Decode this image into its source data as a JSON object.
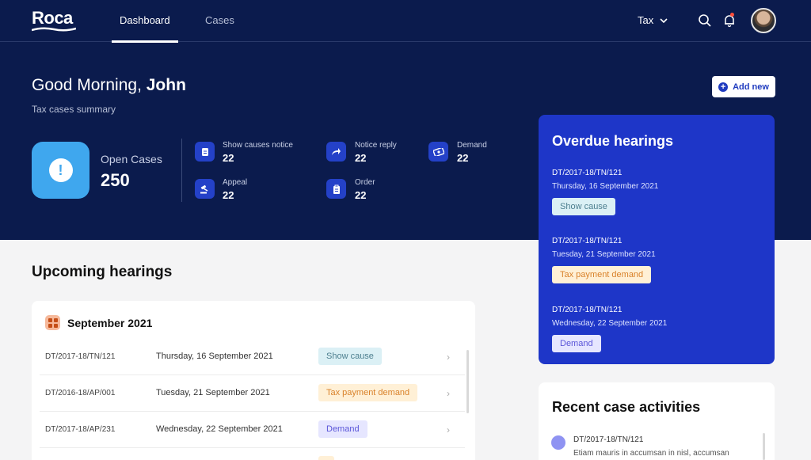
{
  "app": {
    "logo_text": "Roca"
  },
  "nav": {
    "tabs": [
      {
        "label": "Dashboard"
      },
      {
        "label": "Cases"
      }
    ],
    "tax_dropdown": "Tax",
    "icons": [
      "search-icon",
      "bell-icon",
      "avatar"
    ]
  },
  "hero": {
    "greeting_prefix": "Good Morning, ",
    "user_name": "John",
    "subtitle": "Tax cases summary",
    "add_new_label": "Add new",
    "open_cases": {
      "label": "Open Cases",
      "value": "250"
    },
    "stats": [
      {
        "label": "Show causes notice",
        "value": "22",
        "icon": "document-icon"
      },
      {
        "label": "Notice reply",
        "value": "22",
        "icon": "reply-arrow-icon"
      },
      {
        "label": "Demand",
        "value": "22",
        "icon": "money-icon"
      },
      {
        "label": "Appeal",
        "value": "22",
        "icon": "gavel-icon"
      },
      {
        "label": "Order",
        "value": "22",
        "icon": "clipboard-icon"
      }
    ]
  },
  "overdue": {
    "title": "Overdue hearings",
    "items": [
      {
        "case": "DT/2017-18/TN/121",
        "date": "Thursday, 16 September 2021",
        "tag": "Show cause"
      },
      {
        "case": "DT/2017-18/TN/121",
        "date": "Tuesday, 21 September 2021",
        "tag": "Tax payment demand"
      },
      {
        "case": "DT/2017-18/TN/121",
        "date": "Wednesday, 22 September 2021",
        "tag": "Demand"
      }
    ]
  },
  "upcoming": {
    "title": "Upcoming hearings",
    "month": "September 2021",
    "rows": [
      {
        "case": "DT/2017-18/TN/121",
        "date": "Thursday, 16 September 2021",
        "tag": "Show cause"
      },
      {
        "case": "DT/2016-18/AP/001",
        "date": "Tuesday, 21 September 2021",
        "tag": "Tax payment demand"
      },
      {
        "case": "DT/2017-18/AP/231",
        "date": "Wednesday, 22 September 2021",
        "tag": "Demand"
      }
    ]
  },
  "recent": {
    "title": "Recent case activities",
    "items": [
      {
        "case": "DT/2017-18/TN/121",
        "description": "Etiam mauris in accumsan in nisl, accumsan"
      }
    ]
  },
  "colors": {
    "navy": "#0b1b4d",
    "primary_blue": "#1e36c8",
    "open_tile": "#3fa7ee",
    "show_cause_bg": "#dbf0f5",
    "tax_payment_bg": "#fff0d6",
    "demand_bg": "#e6e6ff"
  }
}
